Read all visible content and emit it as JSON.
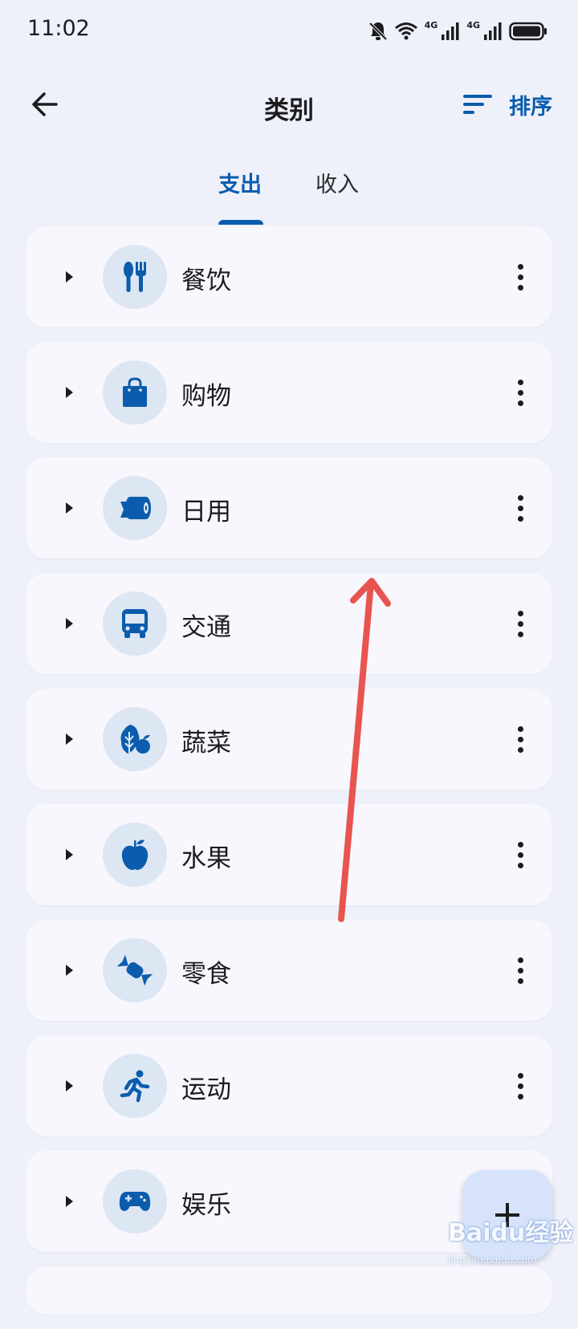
{
  "status_bar": {
    "time": "11:02",
    "net1": "4G",
    "net2": "4G",
    "icons": [
      "bell-off-icon",
      "wifi-icon",
      "signal-icon",
      "signal-icon",
      "battery-icon"
    ]
  },
  "app_bar": {
    "title": "类别",
    "sort_label": "排序",
    "back_icon": "arrow-left-icon",
    "sort_icon": "sort-icon"
  },
  "tabs": [
    {
      "label": "支出",
      "selected": true
    },
    {
      "label": "收入",
      "selected": false
    }
  ],
  "categories": [
    {
      "label": "餐饮",
      "icon": "utensils-icon"
    },
    {
      "label": "购物",
      "icon": "shopping-bag-icon"
    },
    {
      "label": "日用",
      "icon": "toilet-paper-icon"
    },
    {
      "label": "交通",
      "icon": "bus-icon"
    },
    {
      "label": "蔬菜",
      "icon": "vegetable-icon"
    },
    {
      "label": "水果",
      "icon": "apple-icon"
    },
    {
      "label": "零食",
      "icon": "candy-icon"
    },
    {
      "label": "运动",
      "icon": "running-icon"
    },
    {
      "label": "娱乐",
      "icon": "gamepad-icon"
    }
  ],
  "fab": {
    "icon": "plus-icon",
    "label": "+"
  },
  "watermark": {
    "text": "Baidu经验",
    "sub": "jingyan.baidu.com"
  },
  "colors": {
    "accent": "#0b5cad",
    "background": "#eef1f9",
    "card": "#f8f7fd",
    "icon_circle": "#dde6f3",
    "arrow": "#e85450"
  }
}
